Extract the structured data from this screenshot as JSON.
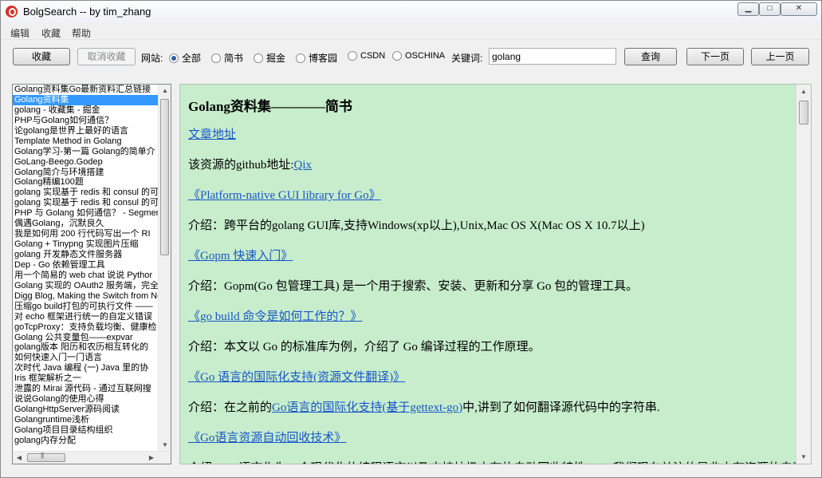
{
  "window": {
    "title": "BolgSearch -- by tim_zhang",
    "icon": "app-logo-icon",
    "controls": [
      "minimize",
      "maximize",
      "close"
    ]
  },
  "menu": {
    "edit": "编辑",
    "favorites": "收藏",
    "help": "帮助"
  },
  "toolbar": {
    "favorite_label": "收藏",
    "unfavorite_label": "取消收藏",
    "site_label": "网站:",
    "sites": [
      {
        "label": "全部",
        "checked": true
      },
      {
        "label": "简书",
        "checked": false
      },
      {
        "label": "掘金",
        "checked": false
      },
      {
        "label": "博客园",
        "checked": false
      },
      {
        "label": "CSDN",
        "checked": false
      },
      {
        "label": "OSCHINA",
        "checked": false
      }
    ],
    "keyword_label": "关键词:",
    "keyword_value": "golang",
    "search_label": "查询",
    "next_label": "下一页",
    "prev_label": "上一页"
  },
  "list": {
    "selected_index": 1,
    "items": [
      "Golang资料集Go最新资料汇总链接",
      "Golang资料集",
      "golang - 收藏集 - 掘金",
      "PHP与Golang如何通信？",
      "论golang是世界上最好的语言",
      "Template Method in Golang",
      "Golang学习-第一篇 Golang的简单介",
      "GoLang-Beego.Godep",
      "Golang简介与环境搭建",
      "Golang精编100题",
      "golang 实现基于 redis 和 consul 的可",
      "golang 实现基于 redis 和 consul 的可",
      "PHP 与 Golang 如何通信？ - Segmen",
      "偶遇Golang，沉默良久",
      "我是如何用 200 行代码写出一个 RI",
      "Golang + Tinypng 实现图片压缩",
      "golang 开发静态文件服务器",
      "Dep - Go 依赖管理工具",
      "用一个简易的 web chat 说说 Pythor",
      "Golang 实现的 OAuth2 服务端，完全",
      "Digg Blog, Making the Switch from Noc",
      "压缩go build打包的可执行文件 ——",
      "对 echo 框架进行统一的自定义错误",
      "goTcpProxy：支持负载均衡、健康检",
      "Golang 公共变量包——expvar",
      "golang版本 阳历和农历相互转化的",
      "如何快速入门一门语言",
      "次时代 Java 编程 (一) Java 里的协",
      "Iris 框架解析之一",
      "泄露的 Mirai 源代码 - 通过互联网搜",
      "说说Golang的使用心得",
      "GolangHttpServer源码阅读",
      "Golangruntime浅析",
      "Golang项目目录结构组织",
      "golang内存分配"
    ]
  },
  "article": {
    "title": "Golang资料集————简书",
    "source_link": "文章地址",
    "github_prefix": "该资源的github地址:",
    "github_link": "Qix",
    "entries": [
      {
        "link": "《Platform-native GUI library for Go》",
        "prefix": "介绍：跨平台的golang GUI库,支持Windows(xp以上),Unix,Mac OS X(Mac OS X 10.7以上)",
        "inline_link": "",
        "suffix": ""
      },
      {
        "link": "《Gopm 快速入门》",
        "prefix": "介绍：Gopm(Go 包管理工具) 是一个用于搜索、安装、更新和分享  Go 包的管理工具。",
        "inline_link": "",
        "suffix": ""
      },
      {
        "link": "《go build 命令是如何工作的？》",
        "prefix": "介绍：本文以  Go 的标准库为例，介绍了  Go 编译过程的工作原理。",
        "inline_link": "",
        "suffix": ""
      },
      {
        "link": "《Go 语言的国际化支持(资源文件翻译)》",
        "prefix": "介绍：在之前的",
        "inline_link": "Go语言的国际化支持(基于gettext-go)",
        "suffix": "中,讲到了如何翻译源代码中的字符串."
      },
      {
        "link": "《Go语言资源自动回收技术》",
        "prefix": "介绍：Go语言作为一个现代化的编程语言以及支持垃圾内存的自动回收特性(GC).我们现在关注的是非内存资源的自动回收技术",
        "inline_link": "",
        "suffix": ""
      }
    ]
  }
}
